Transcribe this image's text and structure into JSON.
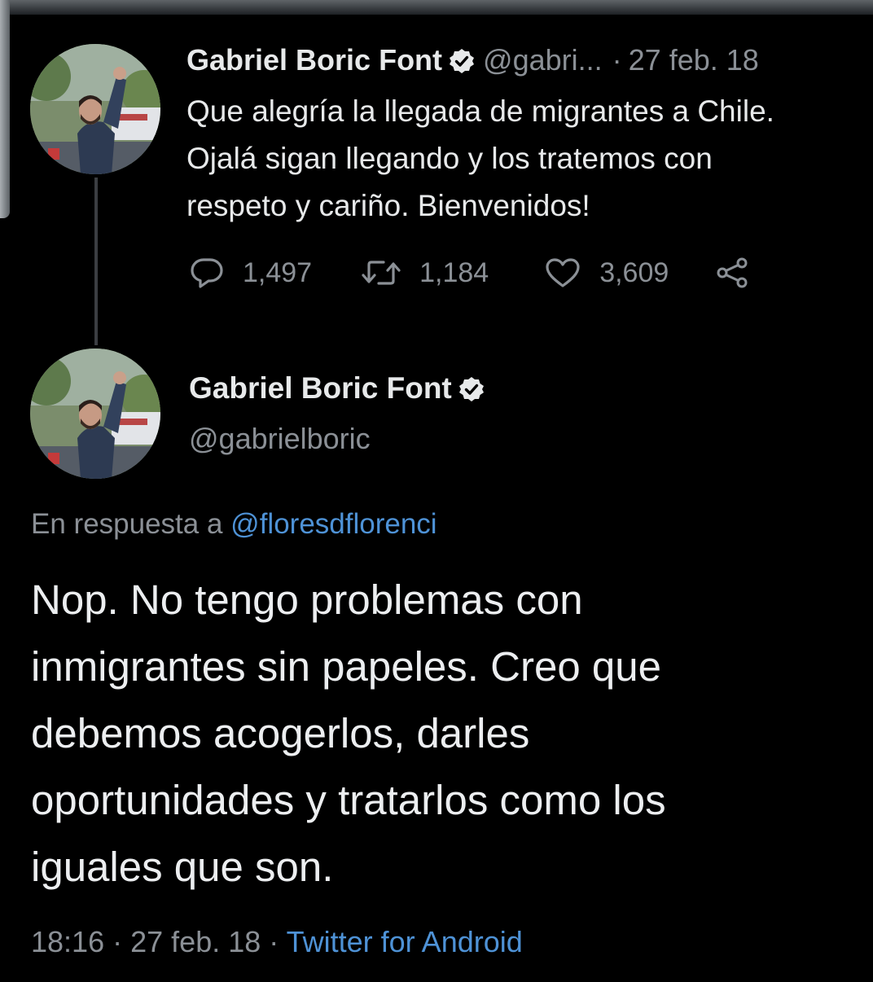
{
  "colors": {
    "background": "#000000",
    "primary_text": "#e7e9ea",
    "secondary_text": "#8b9096",
    "link": "#4e92d6",
    "thread_line": "#3b3e42"
  },
  "tweet1": {
    "author_name": "Gabriel Boric Font",
    "handle_short": "@gabri...",
    "separator": "·",
    "date": "27 feb. 18",
    "text_lines": [
      "Que alegría la llegada de migrantes a Chile.",
      "Ojalá sigan llegando y los tratemos con",
      "respeto y cariño. Bienvenidos!"
    ],
    "replies": "1,497",
    "retweets": "1,184",
    "likes": "3,609",
    "icons": [
      "reply-icon",
      "retweet-icon",
      "like-icon",
      "share-icon"
    ]
  },
  "tweet2": {
    "author_name": "Gabriel Boric Font",
    "handle": "@gabrielboric",
    "reply_prefix": "En respuesta a",
    "reply_to": "@floresdflorenci",
    "text_lines": [
      "Nop. No tengo problemas con",
      "inmigrantes sin papeles. Creo que",
      "debemos acogerlos, darles",
      "oportunidades y tratarlos como los",
      "iguales que son."
    ],
    "time": "18:16",
    "separator": "·",
    "date": "27 feb. 18",
    "source": "Twitter for Android"
  }
}
